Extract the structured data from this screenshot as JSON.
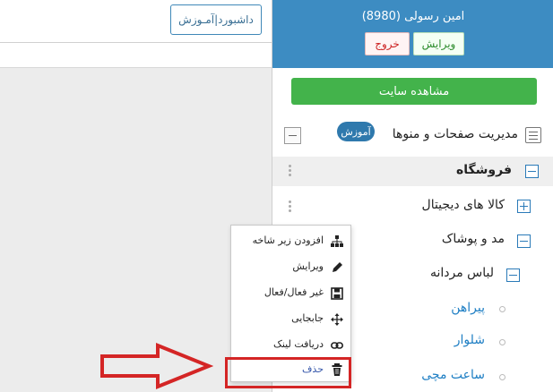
{
  "topbar": {
    "dashboard_button": "داشبورد|آمـوزش"
  },
  "user": {
    "name": "امین رسولی (8980)",
    "edit_label": "ویرایش",
    "logout_label": "خروج"
  },
  "view_site_label": "مشاهده سایت",
  "menu_management": {
    "label": "مدیریت صفحات و منوها",
    "badge": "آموزش"
  },
  "tree": {
    "shop": "فروشگاه",
    "digital": "کالا های دیجیتال",
    "fashion": "مد و پوشاک",
    "men_clothing": "لباس مردانه",
    "shirt": "پیراهن",
    "pants": "شلوار",
    "watch": "ساعت مچی"
  },
  "context_menu": {
    "items": [
      {
        "label": "افزودن زیر شاخه",
        "icon": "sitemap-icon"
      },
      {
        "label": "ویرایش",
        "icon": "pencil-icon"
      },
      {
        "label": "غیر فعال/فعال",
        "icon": "save-icon"
      },
      {
        "label": "جابجایی",
        "icon": "move-icon"
      },
      {
        "label": "دریافت لینک",
        "icon": "link-icon"
      },
      {
        "label": "حذف",
        "icon": "trash-icon"
      }
    ]
  },
  "colors": {
    "header_blue": "#3d8cc2",
    "green": "#43b34b",
    "badge_blue": "#2f79ad",
    "link_blue": "#1f7fc4",
    "highlight_red": "#d42525"
  }
}
